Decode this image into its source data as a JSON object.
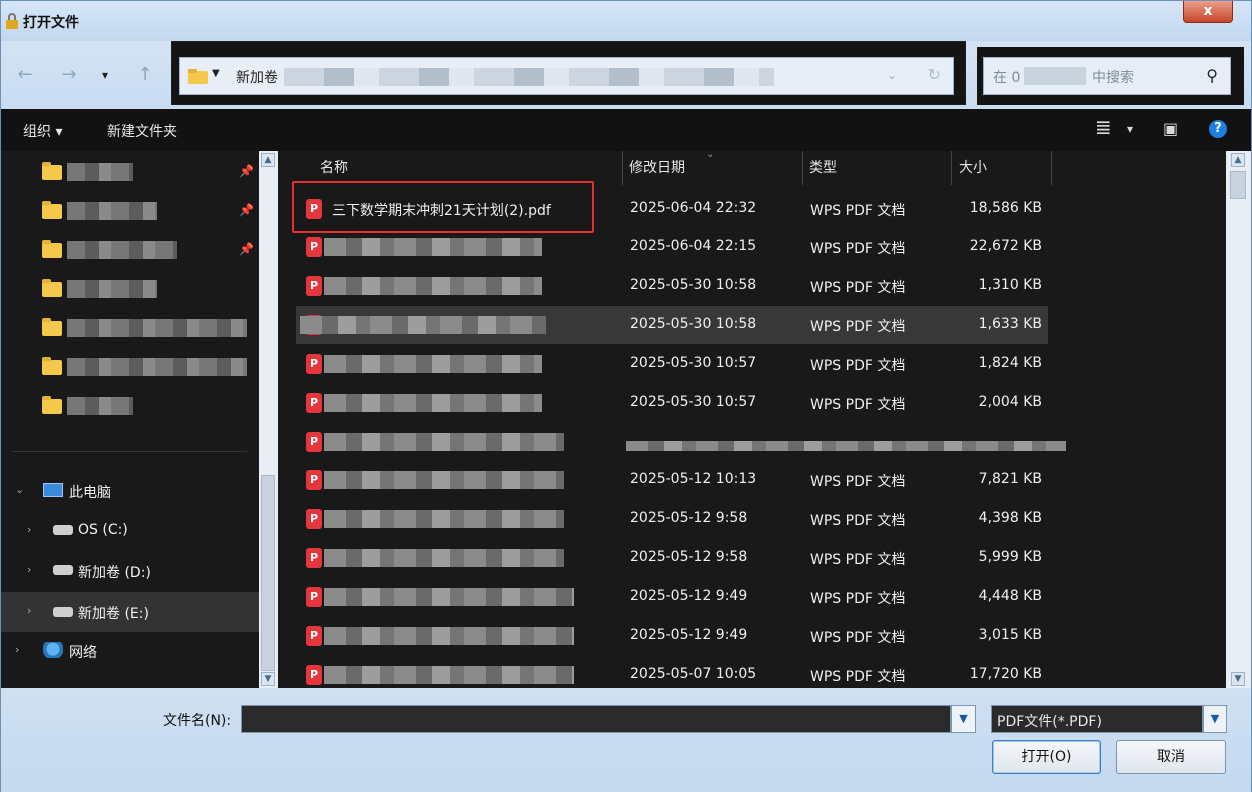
{
  "window": {
    "title": "打开文件",
    "close_label": "x"
  },
  "nav": {
    "back": "←",
    "forward": "→",
    "history": "▾",
    "up": "↑",
    "address_text": "新加卷",
    "address_dropdown": "⌄",
    "refresh": "↻"
  },
  "search": {
    "prefix": "在 0",
    "suffix": "中搜索",
    "icon": "search-icon"
  },
  "toolbar": {
    "organize": "组织 ▾",
    "new_folder": "新建文件夹",
    "view_icon": "≣",
    "view_caret": "▾",
    "preview_icon": "▣",
    "help": "?"
  },
  "tree": {
    "this_pc": "此电脑",
    "drive_c": "OS (C:)",
    "drive_d": "新加卷 (D:)",
    "drive_e": "新加卷 (E:)",
    "network": "网络"
  },
  "columns": {
    "name": "名称",
    "date": "修改日期",
    "type": "类型",
    "size": "大小"
  },
  "files": [
    {
      "name": "三下数学期末冲刺21天计划(2).pdf",
      "date": "2025-06-04 22:32",
      "type": "WPS PDF 文档",
      "size": "18,586 KB"
    },
    {
      "name": "",
      "date": "2025-06-04 22:15",
      "type": "WPS PDF 文档",
      "size": "22,672 KB"
    },
    {
      "name": "",
      "date": "2025-05-30 10:58",
      "type": "WPS PDF 文档",
      "size": "1,310 KB"
    },
    {
      "name": "",
      "date": "2025-05-30 10:58",
      "type": "WPS PDF 文档",
      "size": "1,633 KB"
    },
    {
      "name": "",
      "date": "2025-05-30 10:57",
      "type": "WPS PDF 文档",
      "size": "1,824 KB"
    },
    {
      "name": "",
      "date": "2025-05-30 10:57",
      "type": "WPS PDF 文档",
      "size": "2,004 KB"
    },
    {
      "name": "",
      "date": "",
      "type": "",
      "size": ""
    },
    {
      "name": "",
      "date": "2025-05-12 10:13",
      "type": "WPS PDF 文档",
      "size": "7,821 KB"
    },
    {
      "name": "",
      "date": "2025-05-12 9:58",
      "type": "WPS PDF 文档",
      "size": "4,398 KB"
    },
    {
      "name": "",
      "date": "2025-05-12 9:58",
      "type": "WPS PDF 文档",
      "size": "5,999 KB"
    },
    {
      "name": "",
      "date": "2025-05-12 9:49",
      "type": "WPS PDF 文档",
      "size": "4,448 KB"
    },
    {
      "name": "",
      "date": "2025-05-12 9:49",
      "type": "WPS PDF 文档",
      "size": "3,015 KB"
    },
    {
      "name": "",
      "date": "2025-05-07 10:05",
      "type": "WPS PDF 文档",
      "size": "17,720 KB"
    }
  ],
  "footer": {
    "filename_label": "文件名(N):",
    "filename_value": "",
    "filetype": "PDF文件(*.PDF)",
    "open": "打开(O)",
    "cancel": "取消"
  },
  "colors": {
    "highlight": "#e33030",
    "pdf_icon": "#e5363d",
    "folder": "#f5c84b"
  }
}
